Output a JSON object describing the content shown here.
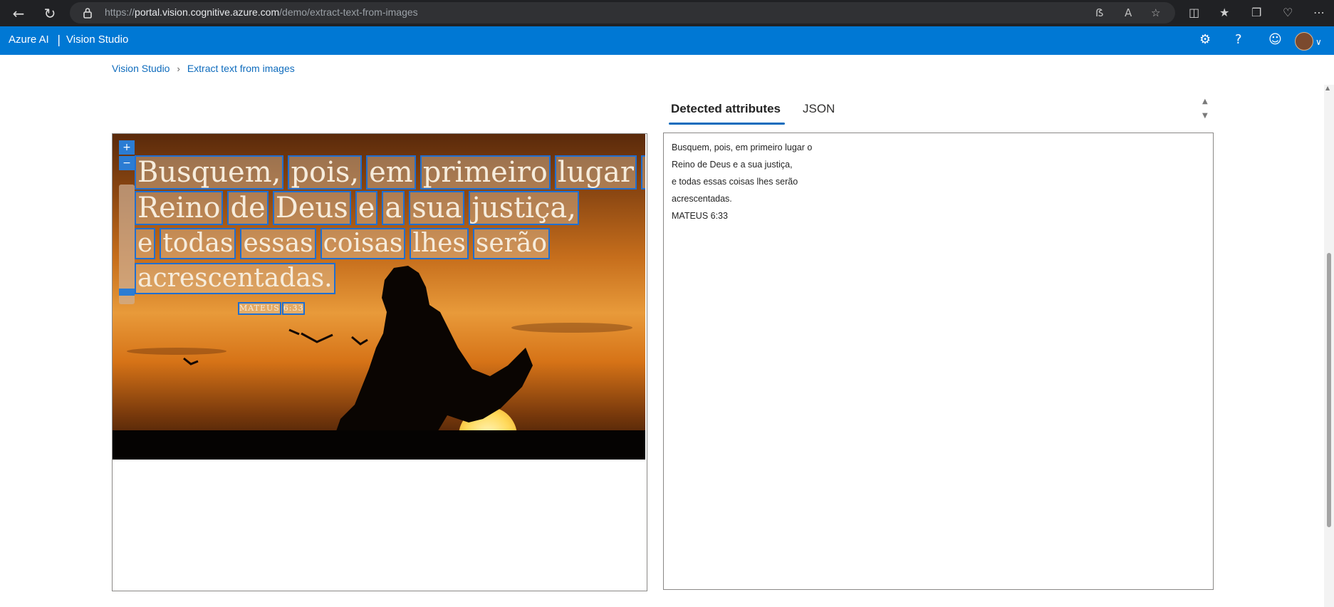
{
  "browser": {
    "url_prefix": "https://",
    "url_host": "portal.vision.cognitive.azure.com",
    "url_path": "/demo/extract-text-from-images"
  },
  "app": {
    "brand": "Azure AI",
    "separator": "|",
    "product": "Vision Studio"
  },
  "breadcrumb": {
    "items": [
      "Vision Studio",
      "Extract text from images"
    ]
  },
  "tabs": {
    "items": [
      "Detected attributes",
      "JSON"
    ],
    "selected": "Detected attributes"
  },
  "image_ocr": {
    "lines": [
      [
        "Busquem,",
        "pois,",
        "em",
        "primeiro",
        "lugar",
        "o"
      ],
      [
        "Reino",
        "de",
        "Deus",
        "e",
        "a",
        "sua",
        "justiça,"
      ],
      [
        "e",
        "todas",
        "essas",
        "coisas",
        "lhes",
        "serão"
      ],
      [
        "acrescentadas."
      ],
      [
        "MATEUS",
        "6:33"
      ]
    ]
  },
  "result_text": {
    "lines": [
      "Busquem, pois, em primeiro lugar o",
      "Reino de Deus e a sua justiça,",
      "e todas essas coisas lhes serão",
      "acrescentadas.",
      "MATEUS 6:33"
    ]
  },
  "colors": {
    "app_header": "#0078d4",
    "accent": "#0f6cbd",
    "box_outline": "#1f6fd1"
  },
  "icons": {
    "browser": [
      "back-icon",
      "refresh-icon",
      "lock-icon",
      "read-aloud-icon",
      "text-size-icon",
      "favorite-star-icon",
      "split-screen-icon",
      "favorites-icon",
      "collections-icon",
      "health-icon",
      "more-icon"
    ],
    "app": [
      "settings-icon",
      "help-icon",
      "feedback-icon",
      "avatar",
      "chevron-down-icon"
    ]
  }
}
